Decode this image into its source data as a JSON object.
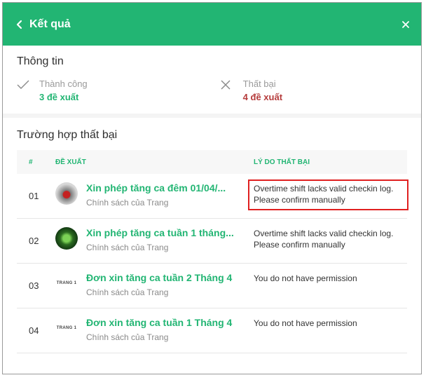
{
  "header": {
    "title": "Kết quả",
    "bg_color": "#22b573"
  },
  "info": {
    "title": "Thông tin",
    "success": {
      "label": "Thành công",
      "value": "3 đề xuất",
      "icon": "check-icon"
    },
    "fail": {
      "label": "Thất bại",
      "value": "4 đề xuất",
      "icon": "x-icon"
    }
  },
  "failures": {
    "title": "Trường hợp thất bại",
    "columns": {
      "num": "#",
      "proposal": "ĐỀ XUẤT",
      "reason": "LÝ DO THẤT BẠI"
    },
    "rows": [
      {
        "num": "01",
        "title": "Xin phép tăng ca đêm 01/04/...",
        "subtitle": "Chính sách của Trang",
        "reason_line1": "Overtime shift lacks valid checkin log.",
        "reason_line2": "Please confirm manually",
        "avatar_text": ""
      },
      {
        "num": "02",
        "title": "Xin phép tăng ca tuần 1 tháng...",
        "subtitle": "Chính sách của Trang",
        "reason_line1": "Overtime shift lacks valid checkin log.",
        "reason_line2": "Please confirm manually",
        "avatar_text": ""
      },
      {
        "num": "03",
        "title": "Đơn xin tăng ca tuần 2 Tháng 4",
        "subtitle": "Chính sách của Trang",
        "reason_line1": "You do not have permission",
        "reason_line2": "",
        "avatar_text": "TRANG 1"
      },
      {
        "num": "04",
        "title": "Đơn xin tăng ca tuần 1 Tháng 4",
        "subtitle": "Chính sách của Trang",
        "reason_line1": "You do not have permission",
        "reason_line2": "",
        "avatar_text": "TRANG 1"
      }
    ]
  }
}
